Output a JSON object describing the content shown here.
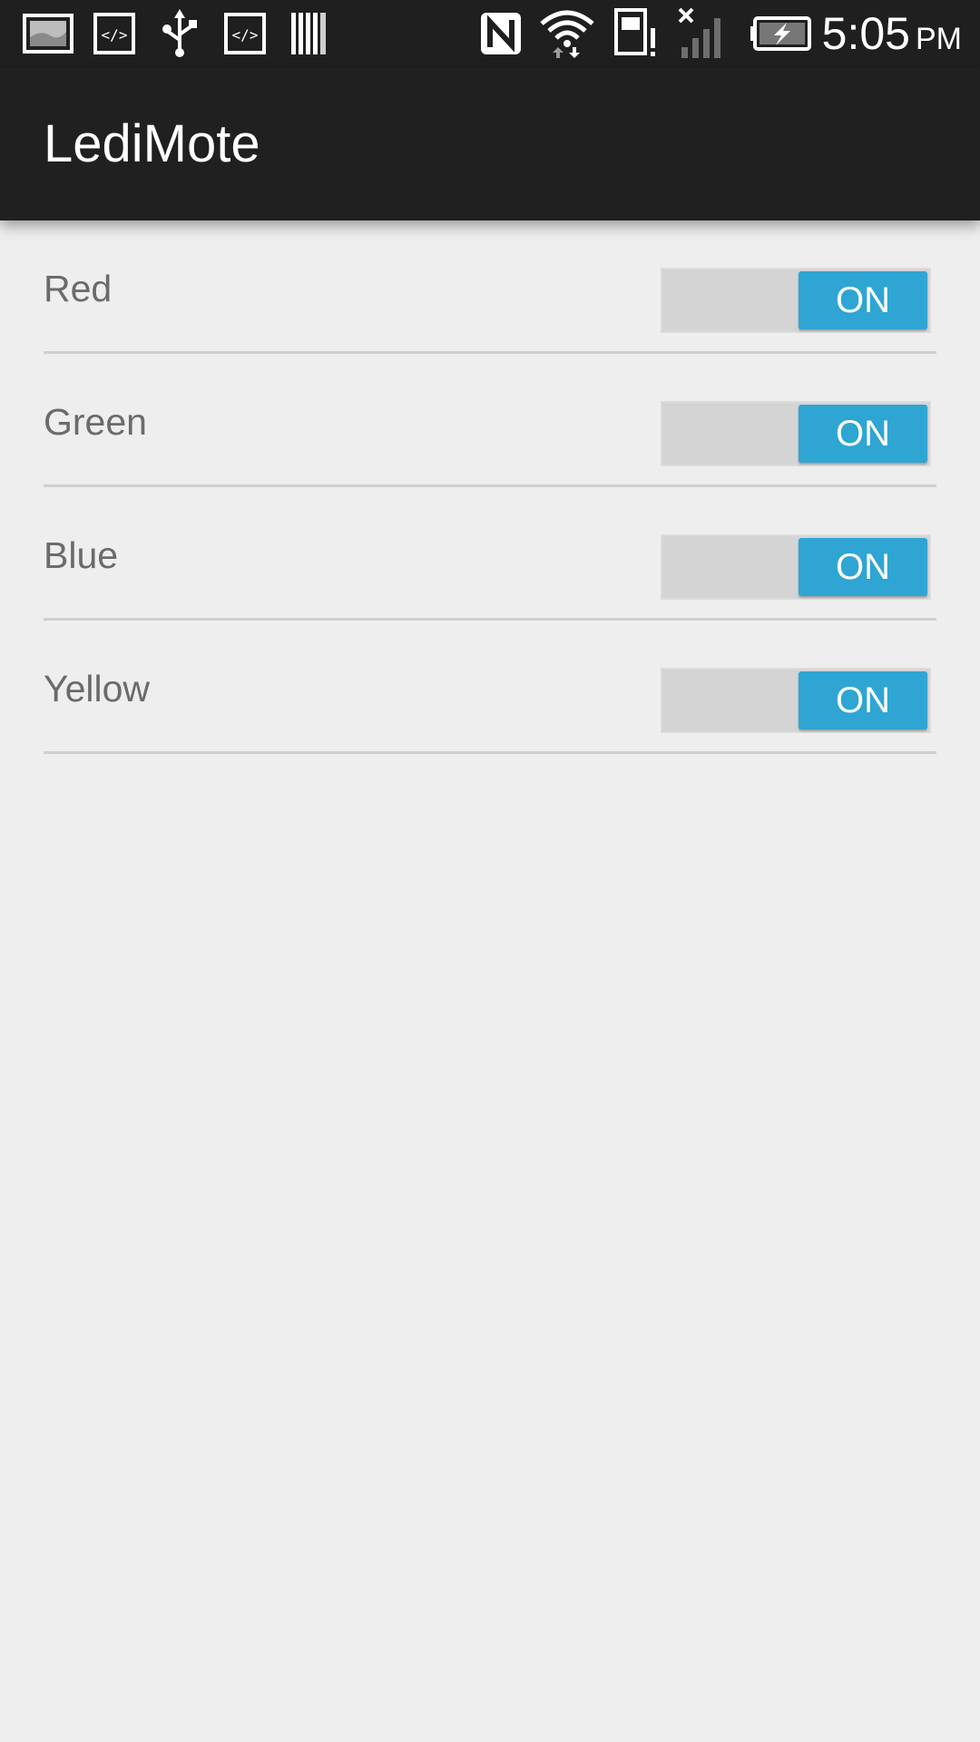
{
  "status_bar": {
    "time": "5:05",
    "ampm": "PM",
    "icons": [
      "gallery-icon",
      "code-icon",
      "usb-icon",
      "code-icon",
      "barcode-icon",
      "nfc-icon",
      "wifi-icon",
      "sd-card-alert-icon",
      "no-signal-icon",
      "battery-charging-icon"
    ]
  },
  "app": {
    "title": "LediMote"
  },
  "colors": {
    "status_bar": "#1f1f1f",
    "action_bar": "#202020",
    "background": "#eeeeef",
    "switch_on": "#2fa5d3",
    "switch_track": "#d4d4d5",
    "label_text": "#6b6b6b",
    "divider": "#cfcfd0"
  },
  "items": [
    {
      "label": "Red",
      "state": "ON"
    },
    {
      "label": "Green",
      "state": "ON"
    },
    {
      "label": "Blue",
      "state": "ON"
    },
    {
      "label": "Yellow",
      "state": "ON"
    }
  ]
}
